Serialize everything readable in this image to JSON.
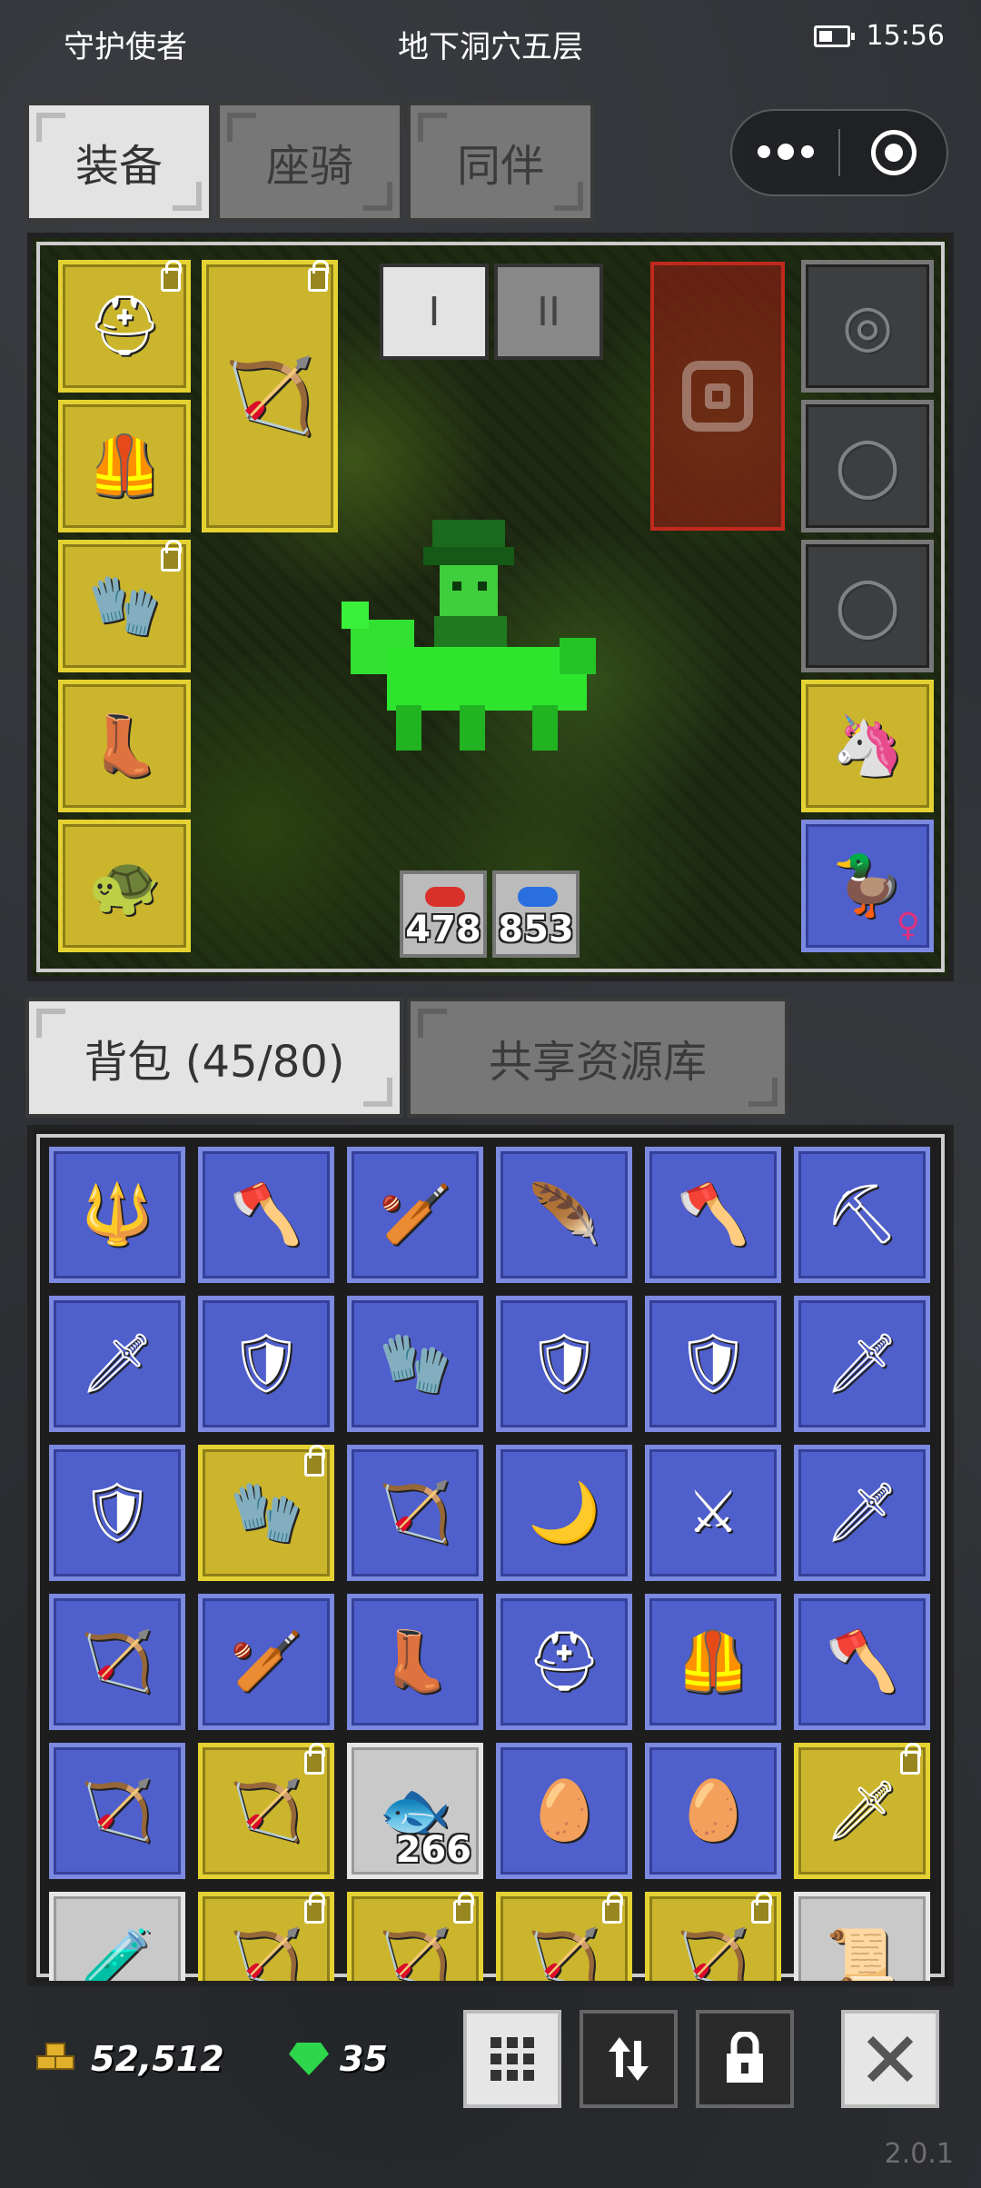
{
  "status_bar": {
    "left_title": "守护使者",
    "location": "地下洞穴五层",
    "time": "15:56"
  },
  "top_tabs": [
    {
      "label": "装备",
      "active": true
    },
    {
      "label": "座骑",
      "active": false
    },
    {
      "label": "同伴",
      "active": false
    }
  ],
  "tier_tabs": [
    {
      "label": "I",
      "active": true
    },
    {
      "label": "II",
      "active": false
    }
  ],
  "equipment_slots": [
    {
      "name": "helmet",
      "icon": "helmet-icon",
      "locked": true
    },
    {
      "name": "chest-armor",
      "icon": "armor-icon",
      "locked": false
    },
    {
      "name": "gloves",
      "icon": "glove-icon",
      "locked": true
    },
    {
      "name": "boots",
      "icon": "boots-icon",
      "locked": false
    },
    {
      "name": "mount-gear",
      "icon": "turtle-icon",
      "locked": false
    },
    {
      "name": "weapon",
      "icon": "crossbow-icon",
      "locked": true
    }
  ],
  "right_slots": [
    {
      "name": "amulet",
      "icon": "amulet-icon",
      "empty": true
    },
    {
      "name": "ring-1",
      "icon": "ring-icon",
      "empty": true
    },
    {
      "name": "ring-2",
      "icon": "ring-icon",
      "empty": true
    },
    {
      "name": "pet-unicorn",
      "icon": "unicorn-portrait-icon"
    },
    {
      "name": "companion",
      "icon": "duck-portrait-icon",
      "gender": "♀"
    }
  ],
  "stats": {
    "red_potion_count": "478",
    "blue_potion_count": "853"
  },
  "bag_tabs": [
    {
      "label": "背包 (45/80)",
      "active": true
    },
    {
      "label": "共享资源库",
      "active": false
    }
  ],
  "bag_items": [
    {
      "icon": "trident-icon",
      "glyph": "🔱",
      "bg": "blue"
    },
    {
      "icon": "axe-icon",
      "glyph": "🪓",
      "bg": "blue"
    },
    {
      "icon": "club-icon",
      "glyph": "🏏",
      "bg": "blue"
    },
    {
      "icon": "feather-icon",
      "glyph": "🪶",
      "bg": "blue"
    },
    {
      "icon": "axe-icon",
      "glyph": "🪓",
      "bg": "blue"
    },
    {
      "icon": "pickaxe-icon",
      "glyph": "⛏",
      "bg": "blue"
    },
    {
      "icon": "spear-icon",
      "glyph": "🗡",
      "bg": "blue"
    },
    {
      "icon": "round-shield-icon",
      "glyph": "🛡",
      "bg": "blue"
    },
    {
      "icon": "glove-icon",
      "glyph": "🧤",
      "bg": "blue"
    },
    {
      "icon": "gold-shield-icon",
      "glyph": "🛡",
      "bg": "blue"
    },
    {
      "icon": "gold-shield-icon",
      "glyph": "🛡",
      "bg": "blue"
    },
    {
      "icon": "spear-icon",
      "glyph": "🗡",
      "bg": "blue"
    },
    {
      "icon": "round-shield-icon",
      "glyph": "🛡",
      "bg": "blue"
    },
    {
      "icon": "glove-icon",
      "glyph": "🧤",
      "bg": "yellow",
      "locked": true
    },
    {
      "icon": "crossbow-icon",
      "glyph": "🏹",
      "bg": "blue"
    },
    {
      "icon": "sickle-icon",
      "glyph": "🌙",
      "bg": "blue"
    },
    {
      "icon": "sword-icon",
      "glyph": "⚔",
      "bg": "blue"
    },
    {
      "icon": "spear-icon",
      "glyph": "🗡",
      "bg": "blue"
    },
    {
      "icon": "crossbow-icon",
      "glyph": "🏹",
      "bg": "blue"
    },
    {
      "icon": "club-icon",
      "glyph": "🏏",
      "bg": "blue"
    },
    {
      "icon": "boots-icon",
      "glyph": "👢",
      "bg": "blue"
    },
    {
      "icon": "red-helmet-icon",
      "glyph": "⛑",
      "bg": "blue"
    },
    {
      "icon": "armor-icon",
      "glyph": "🦺",
      "bg": "blue"
    },
    {
      "icon": "axe-icon",
      "glyph": "🪓",
      "bg": "blue"
    },
    {
      "icon": "crossbow-icon",
      "glyph": "🏹",
      "bg": "blue"
    },
    {
      "icon": "bow-icon",
      "glyph": "🏹",
      "bg": "yellow",
      "locked": true
    },
    {
      "icon": "fish-icon",
      "glyph": "🐟",
      "bg": "white",
      "qty": "266"
    },
    {
      "icon": "spotted-egg-icon",
      "glyph": "🥚",
      "bg": "blue"
    },
    {
      "icon": "teal-egg-icon",
      "glyph": "🥚",
      "bg": "blue"
    },
    {
      "icon": "red-spear-icon",
      "glyph": "🗡",
      "bg": "yellow",
      "locked": true
    },
    {
      "icon": "potion-icon",
      "glyph": "🧪",
      "bg": "white"
    },
    {
      "icon": "bow-icon",
      "glyph": "🏹",
      "bg": "yellow",
      "locked": true
    },
    {
      "icon": "bow-icon",
      "glyph": "🏹",
      "bg": "yellow",
      "locked": true
    },
    {
      "icon": "crossbow-icon",
      "glyph": "🏹",
      "bg": "yellow",
      "locked": true
    },
    {
      "icon": "bow-icon",
      "glyph": "🏹",
      "bg": "yellow",
      "locked": true
    },
    {
      "icon": "scroll-icon",
      "glyph": "📜",
      "bg": "white"
    }
  ],
  "currency": {
    "gold": "52,512",
    "gems": "35"
  },
  "tools": [
    {
      "name": "grid-view-button",
      "icon": "grid-icon",
      "style": "light"
    },
    {
      "name": "sort-button",
      "icon": "sort-icon",
      "style": "dark"
    },
    {
      "name": "lock-button",
      "icon": "lock-icon",
      "style": "dark"
    },
    {
      "name": "close-button",
      "icon": "close-icon",
      "style": "light"
    }
  ],
  "version": "2.0.1",
  "colors": {
    "slot_yellow": "#cbb52c",
    "slot_blue": "#4f5fcc",
    "slot_white": "#c9c9c9",
    "gem_green": "#2dd64a",
    "gold": "#e2b12c"
  }
}
